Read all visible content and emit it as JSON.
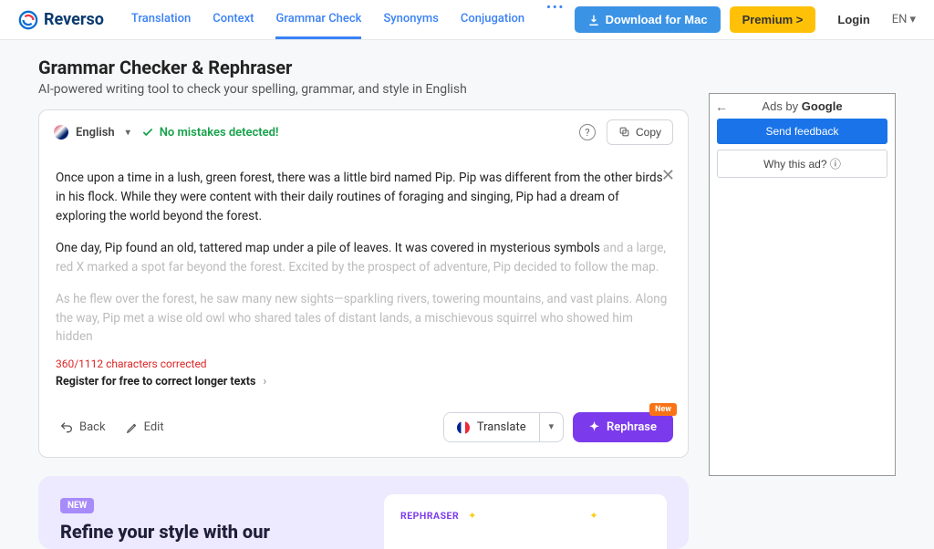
{
  "header": {
    "brand": "Reverso",
    "nav": {
      "translation": "Translation",
      "context": "Context",
      "grammar": "Grammar Check",
      "synonyms": "Synonyms",
      "conjugation": "Conjugation"
    },
    "download": "Download for Mac",
    "premium": "Premium >",
    "login": "Login",
    "lang": "EN"
  },
  "page": {
    "title": "Grammar Checker & Rephraser",
    "subtitle": "AI-powered writing tool to check your spelling, grammar, and style in English"
  },
  "editor": {
    "language": "English",
    "status": "No mistakes detected!",
    "copy": "Copy",
    "text": {
      "p1": "Once upon a time in a lush, green forest, there was a little bird named Pip. Pip was different from the other birds in his flock. While they were content with their daily routines of foraging and singing, Pip had a dream of exploring the world beyond the forest.",
      "p2a": "One day, Pip found an old, tattered map under a pile of leaves. It was covered in mysterious symbols",
      "p2b": " and a large, red X marked a spot far beyond the forest. Excited by the prospect of adventure, Pip decided to follow the map.",
      "p3": "As he flew over the forest, he saw many new sights—sparkling rivers, towering mountains, and vast plains. Along the way, Pip met a wise old owl who shared tales of distant lands, a mischievous squirrel who showed him hidden"
    },
    "char_note": "360/1112 characters corrected",
    "register": "Register for free to correct longer texts",
    "back": "Back",
    "edit": "Edit",
    "translate": "Translate",
    "rephrase": "Rephrase",
    "new_badge": "New"
  },
  "promo": {
    "badge": "NEW",
    "title": "Refine your style with our",
    "card_label": "REPHRASER"
  },
  "ad": {
    "title_pre": "Ads by ",
    "title_b": "Google",
    "feedback": "Send feedback",
    "why": "Why this ad? ⓘ"
  }
}
